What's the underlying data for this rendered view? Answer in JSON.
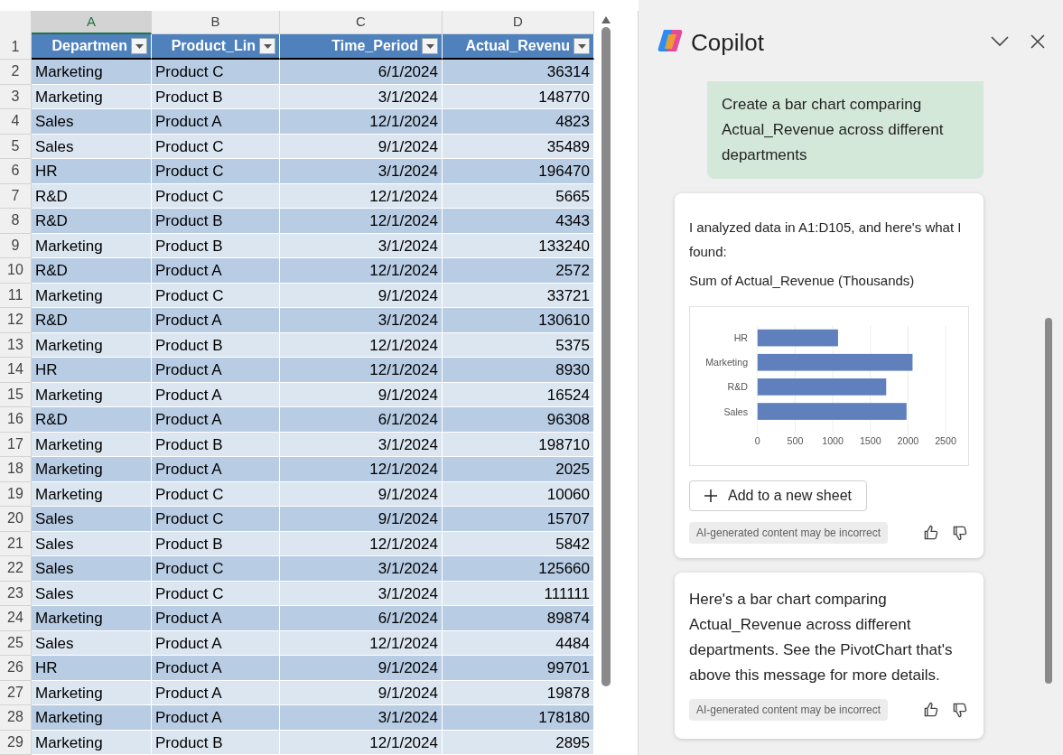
{
  "sheet": {
    "column_letters": [
      {
        "label": "A",
        "selected": true
      },
      {
        "label": "B",
        "selected": false
      },
      {
        "label": "C",
        "selected": false
      },
      {
        "label": "D",
        "selected": false
      }
    ],
    "headers": [
      "Departmen",
      "Product_Lin",
      "Time_Period",
      "Actual_Revenu"
    ],
    "rows": [
      {
        "n": "2",
        "cells": [
          "Marketing",
          "Product C",
          "6/1/2024",
          "36314"
        ]
      },
      {
        "n": "3",
        "cells": [
          "Marketing",
          "Product B",
          "3/1/2024",
          "148770"
        ]
      },
      {
        "n": "4",
        "cells": [
          "Sales",
          "Product A",
          "12/1/2024",
          "4823"
        ]
      },
      {
        "n": "5",
        "cells": [
          "Sales",
          "Product C",
          "9/1/2024",
          "35489"
        ]
      },
      {
        "n": "6",
        "cells": [
          "HR",
          "Product C",
          "3/1/2024",
          "196470"
        ]
      },
      {
        "n": "7",
        "cells": [
          "R&D",
          "Product C",
          "12/1/2024",
          "5665"
        ]
      },
      {
        "n": "8",
        "cells": [
          "R&D",
          "Product B",
          "12/1/2024",
          "4343"
        ]
      },
      {
        "n": "9",
        "cells": [
          "Marketing",
          "Product B",
          "3/1/2024",
          "133240"
        ]
      },
      {
        "n": "10",
        "cells": [
          "R&D",
          "Product A",
          "12/1/2024",
          "2572"
        ]
      },
      {
        "n": "11",
        "cells": [
          "Marketing",
          "Product C",
          "9/1/2024",
          "33721"
        ]
      },
      {
        "n": "12",
        "cells": [
          "R&D",
          "Product A",
          "3/1/2024",
          "130610"
        ]
      },
      {
        "n": "13",
        "cells": [
          "Marketing",
          "Product B",
          "12/1/2024",
          "5375"
        ]
      },
      {
        "n": "14",
        "cells": [
          "HR",
          "Product A",
          "12/1/2024",
          "8930"
        ]
      },
      {
        "n": "15",
        "cells": [
          "Marketing",
          "Product A",
          "9/1/2024",
          "16524"
        ]
      },
      {
        "n": "16",
        "cells": [
          "R&D",
          "Product A",
          "6/1/2024",
          "96308"
        ]
      },
      {
        "n": "17",
        "cells": [
          "Marketing",
          "Product B",
          "3/1/2024",
          "198710"
        ]
      },
      {
        "n": "18",
        "cells": [
          "Marketing",
          "Product A",
          "12/1/2024",
          "2025"
        ]
      },
      {
        "n": "19",
        "cells": [
          "Marketing",
          "Product C",
          "9/1/2024",
          "10060"
        ]
      },
      {
        "n": "20",
        "cells": [
          "Sales",
          "Product C",
          "9/1/2024",
          "15707"
        ]
      },
      {
        "n": "21",
        "cells": [
          "Sales",
          "Product B",
          "12/1/2024",
          "5842"
        ]
      },
      {
        "n": "22",
        "cells": [
          "Sales",
          "Product C",
          "3/1/2024",
          "125660"
        ]
      },
      {
        "n": "23",
        "cells": [
          "Sales",
          "Product C",
          "3/1/2024",
          "111111"
        ]
      },
      {
        "n": "24",
        "cells": [
          "Marketing",
          "Product A",
          "6/1/2024",
          "89874"
        ]
      },
      {
        "n": "25",
        "cells": [
          "Sales",
          "Product A",
          "12/1/2024",
          "4484"
        ]
      },
      {
        "n": "26",
        "cells": [
          "HR",
          "Product A",
          "9/1/2024",
          "99701"
        ]
      },
      {
        "n": "27",
        "cells": [
          "Marketing",
          "Product A",
          "9/1/2024",
          "19878"
        ]
      },
      {
        "n": "28",
        "cells": [
          "Marketing",
          "Product A",
          "3/1/2024",
          "178180"
        ]
      },
      {
        "n": "29",
        "cells": [
          "Marketing",
          "Product B",
          "12/1/2024",
          "2895"
        ]
      }
    ],
    "header_row_number": "1"
  },
  "copilot": {
    "title": "Copilot",
    "user_message": "Create a bar chart comparing Actual_Revenue across different departments",
    "responses": [
      {
        "kind": "chart",
        "intro": "I analyzed data in A1:D105, and here's what I found:",
        "subtitle": "Sum of Actual_Revenue (Thousands)",
        "chart_data": {
          "type": "bar",
          "orientation": "horizontal",
          "categories": [
            "HR",
            "Marketing",
            "R&D",
            "Sales"
          ],
          "values": [
            1070,
            2060,
            1710,
            1980
          ],
          "xlim": [
            0,
            2500
          ],
          "xticks": [
            0,
            500,
            1000,
            1500,
            2000,
            2500
          ],
          "grid": true
        },
        "action": "Add to a new sheet",
        "disclaimer": "AI-generated content may be incorrect"
      },
      {
        "kind": "text",
        "text": "Here's a bar chart comparing Actual_Revenue across different departments. See the PivotChart that's above this message for more details.",
        "disclaimer": "AI-generated content may be incorrect"
      }
    ]
  }
}
